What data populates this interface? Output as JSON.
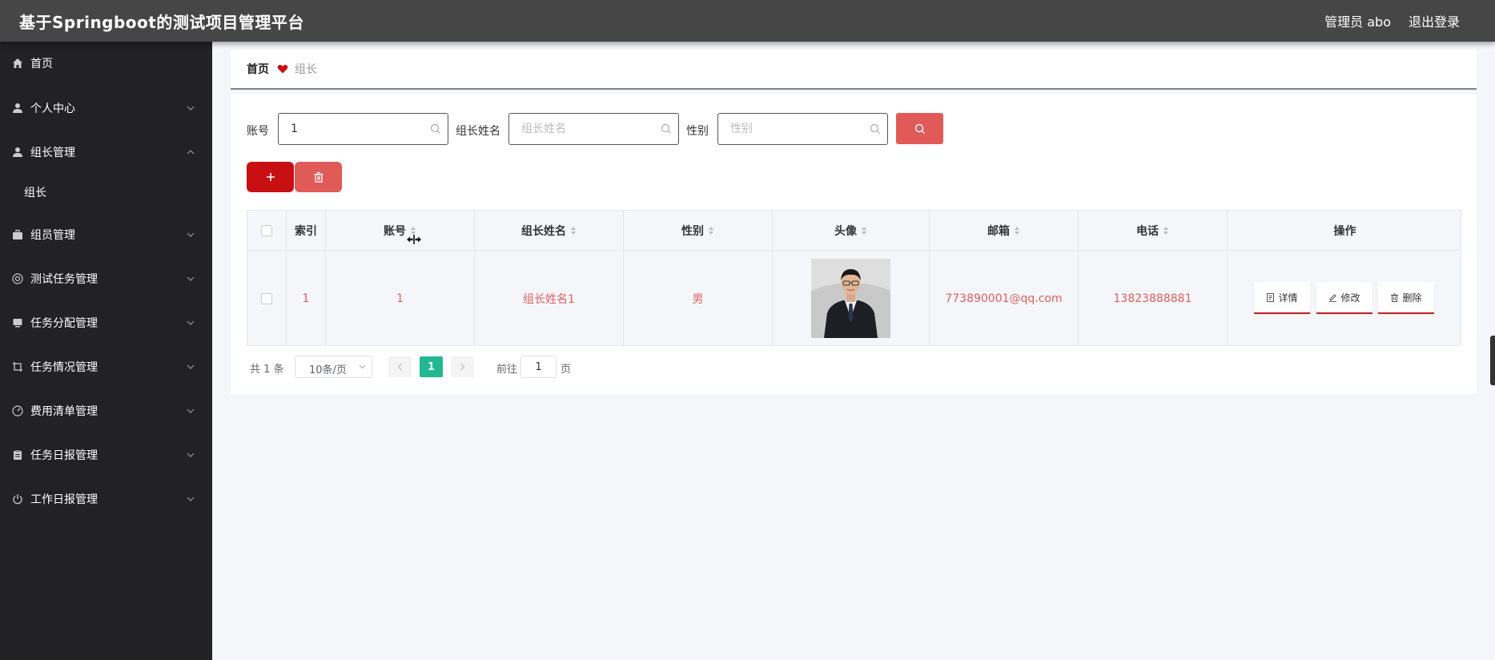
{
  "header": {
    "title": "基于Springboot的测试项目管理平台",
    "user": "管理员 abo",
    "logout": "退出登录"
  },
  "sidebar": {
    "items": [
      {
        "label": "首页",
        "icon": "home-icon",
        "has_arrow": false
      },
      {
        "label": "个人中心",
        "icon": "user-icon",
        "has_arrow": true,
        "expanded": false
      },
      {
        "label": "组长管理",
        "icon": "user-icon",
        "has_arrow": true,
        "expanded": true
      },
      {
        "label": "组员管理",
        "icon": "briefcase-icon",
        "has_arrow": true,
        "expanded": false
      },
      {
        "label": "测试任务管理",
        "icon": "settings-circle-icon",
        "has_arrow": true,
        "expanded": false
      },
      {
        "label": "任务分配管理",
        "icon": "monitor-icon",
        "has_arrow": true,
        "expanded": false
      },
      {
        "label": "任务情况管理",
        "icon": "crop-icon",
        "has_arrow": true,
        "expanded": false
      },
      {
        "label": "费用清单管理",
        "icon": "gauge-icon",
        "has_arrow": true,
        "expanded": false
      },
      {
        "label": "任务日报管理",
        "icon": "clipboard-icon",
        "has_arrow": true,
        "expanded": false
      },
      {
        "label": "工作日报管理",
        "icon": "power-icon",
        "has_arrow": true,
        "expanded": false
      }
    ],
    "submenu": [
      {
        "label": "组长"
      }
    ]
  },
  "breadcrumb": {
    "home": "首页",
    "current": "组长"
  },
  "search": {
    "fields": [
      {
        "label": "账号",
        "value": "1",
        "placeholder": "账号"
      },
      {
        "label": "组长姓名",
        "value": "",
        "placeholder": "组长姓名"
      },
      {
        "label": "性别",
        "value": "",
        "placeholder": "性别"
      }
    ]
  },
  "table": {
    "columns": [
      "索引",
      "账号",
      "组长姓名",
      "性别",
      "头像",
      "邮箱",
      "电话",
      "操作"
    ],
    "rows": [
      {
        "index": "1",
        "account": "1",
        "name": "组长姓名1",
        "gender": "男",
        "email": "773890001@qq.com",
        "phone": "13823888881"
      }
    ],
    "actions": {
      "detail": "详情",
      "edit": "修改",
      "delete": "删除"
    }
  },
  "pagination": {
    "total": "共 1 条",
    "page_size": "10条/页",
    "current_page": "1",
    "goto_prefix": "前往",
    "goto_value": "1",
    "goto_suffix": "页"
  },
  "colors": {
    "header_bg": "#464646",
    "sidebar_bg": "#222225",
    "primary_red": "#c80f12",
    "light_red": "#e05a58",
    "page_active": "#23b891",
    "cell_text": "#e06060"
  }
}
